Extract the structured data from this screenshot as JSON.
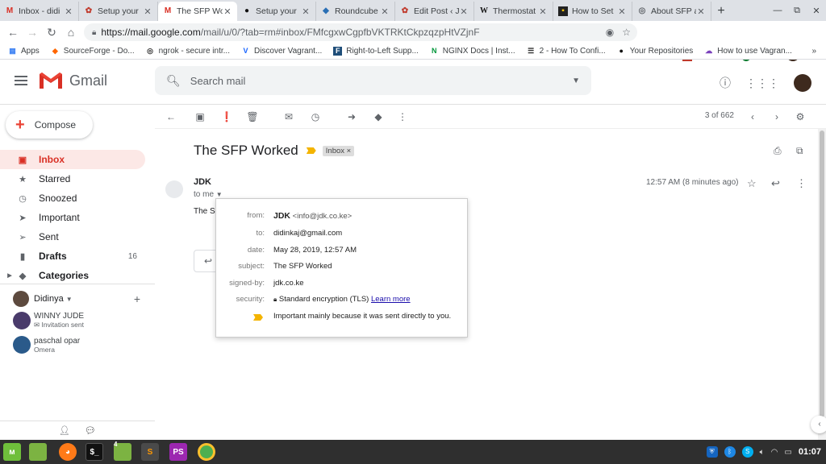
{
  "browser": {
    "tabs": [
      {
        "title": "Inbox - didi",
        "icon": "gmail-icon",
        "active": false
      },
      {
        "title": "Setup your",
        "icon": "jenkins-icon",
        "active": false
      },
      {
        "title": "The SFP Wo",
        "icon": "gmail-icon",
        "active": true
      },
      {
        "title": "Setup your",
        "icon": "github-icon",
        "active": false
      },
      {
        "title": "Roundcube",
        "icon": "roundcube-icon",
        "active": false
      },
      {
        "title": "Edit Post ‹ J",
        "icon": "wordpress-icon",
        "active": false
      },
      {
        "title": "Thermostat",
        "icon": "wikipedia-icon",
        "active": false
      },
      {
        "title": "How to Set",
        "icon": "howto-icon",
        "active": false
      },
      {
        "title": "About SFP a",
        "icon": "globe-icon",
        "active": false
      }
    ],
    "url_host": "https://mail.google.com",
    "url_path": "/mail/u/0/?tab=rm#inbox/FMfcgxwCgpfbVKTRKtCkpzqzpHtVZjnF",
    "bookmarks": [
      {
        "label": "Apps",
        "icon": "apps-grid-icon"
      },
      {
        "label": "SourceForge - Do...",
        "icon": "sourceforge-icon"
      },
      {
        "label": "ngrok - secure intr...",
        "icon": "ngrok-icon"
      },
      {
        "label": "Discover Vagrant...",
        "icon": "vagrant-icon"
      },
      {
        "label": "Right-to-Left Supp...",
        "icon": "f-icon"
      },
      {
        "label": "NGINX Docs | Inst...",
        "icon": "nginx-icon"
      },
      {
        "label": "2 - How To Confi...",
        "icon": "doc-icon"
      },
      {
        "label": "Your Repositories",
        "icon": "github-icon"
      },
      {
        "label": "How to use Vagran...",
        "icon": "vagrant-purple-icon"
      }
    ]
  },
  "gmail": {
    "brand": "Gmail",
    "search_placeholder": "Search mail",
    "compose_label": "Compose",
    "nav": [
      {
        "label": "Inbox",
        "icon": "inbox-icon",
        "active": true,
        "count": ""
      },
      {
        "label": "Starred",
        "icon": "star-icon",
        "count": ""
      },
      {
        "label": "Snoozed",
        "icon": "clock-icon",
        "count": ""
      },
      {
        "label": "Important",
        "icon": "important-icon",
        "count": ""
      },
      {
        "label": "Sent",
        "icon": "send-icon",
        "count": ""
      },
      {
        "label": "Drafts",
        "icon": "draft-icon",
        "count": "16",
        "bold": true
      },
      {
        "label": "Categories",
        "icon": "label-icon",
        "count": "",
        "bold": true
      }
    ],
    "hangouts_user": "Didinya",
    "contacts": [
      {
        "name": "WINNY JUDE",
        "status": "Invitation sent"
      },
      {
        "name": "paschal opar",
        "status": "Omera"
      }
    ],
    "pager": "3 of 662",
    "subject": "The SFP Worked",
    "label": "Inbox",
    "sender": "JDK",
    "to_me": "to me",
    "body_preview": "The S",
    "timestamp": "12:57 AM (8 minutes ago)",
    "details": {
      "from_key": "from:",
      "from_name": "JDK",
      "from_email": "<info@jdk.co.ke>",
      "to_key": "to:",
      "to": "didinkaj@gmail.com",
      "date_key": "date:",
      "date": "May 28, 2019, 12:57 AM",
      "subject_key": "subject:",
      "subject": "The SFP Worked",
      "signed_key": "signed-by:",
      "signed": "jdk.co.ke",
      "security_key": "security:",
      "security": "Standard encryption (TLS)",
      "learn_more": "Learn more",
      "importance": "Important mainly because it was sent directly to you."
    }
  },
  "taskbar": {
    "workspace_badge": "4",
    "clock": "01:07"
  },
  "colors": {
    "gmail_red": "#d93025",
    "importance_yellow": "#f4b400"
  }
}
